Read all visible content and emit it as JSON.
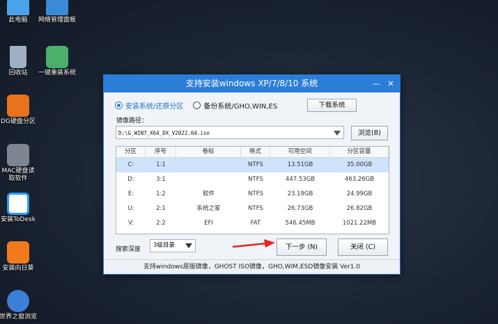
{
  "desktop": {
    "icons": [
      {
        "label": "此电脑",
        "color": "#4aa3e8"
      },
      {
        "label": "网络管理面板",
        "color": "#3a8ad8"
      },
      {
        "label": "回收站",
        "color": "#9fb0c2"
      },
      {
        "label": "一键重装系统",
        "color": "#4bb06b"
      },
      {
        "label": "DG硬盘分区",
        "color": "#e8731f"
      },
      {
        "label": "MAC硬盘读\n取软件",
        "color": "#7d8691"
      },
      {
        "label": "安装ToDesk",
        "color": "#2a9ef0"
      },
      {
        "label": "安装向日葵",
        "color": "#f07a1c"
      },
      {
        "label": "世界之窗浏览",
        "color": "#3b7fd6"
      }
    ]
  },
  "window": {
    "title": "支持安装windows XP/7/8/10 系统",
    "minimize": "—",
    "close": "✕",
    "mode_install": "安装系统/还原分区",
    "mode_backup": "备份系统/GHO,WIN,ES",
    "download_button": "下载系统",
    "image_path_label": "镜像路径：",
    "image_path_value": "D:\\G_WIN7_X64_DX_V2022.04.iso",
    "browse_button": "浏览(B)",
    "table": {
      "headers": [
        "分区",
        "序号",
        "卷标",
        "格式",
        "可用空间",
        "分区容量"
      ],
      "rows": [
        [
          "C:",
          "1:1",
          "",
          "NTFS",
          "13.51GB",
          "35.00GB"
        ],
        [
          "D:",
          "3:1",
          "",
          "NTFS",
          "447.53GB",
          "463.26GB"
        ],
        [
          "E:",
          "1:2",
          "软件",
          "NTFS",
          "23.19GB",
          "24.99GB"
        ],
        [
          "U:",
          "2:1",
          "系统之家",
          "NTFS",
          "26.73GB",
          "26.82GB"
        ],
        [
          "V:",
          "2:2",
          "EFI",
          "FAT",
          "546.45MB",
          "1021.22MB"
        ]
      ],
      "selected_row": 0
    },
    "search_depth_label": "搜索深度",
    "search_depth_value": "3级目录",
    "next_button": "下一步 (N)",
    "close_button": "关闭 (C)",
    "footer": "支持windows原版镜像，GHOST ISO镜像，GHO,WIM,ESD镜像安装 Ver1.0"
  },
  "colors": {
    "accent": "#2b7ed8",
    "arrow": "#e8231f",
    "selected_row": "#cfe4fb"
  }
}
